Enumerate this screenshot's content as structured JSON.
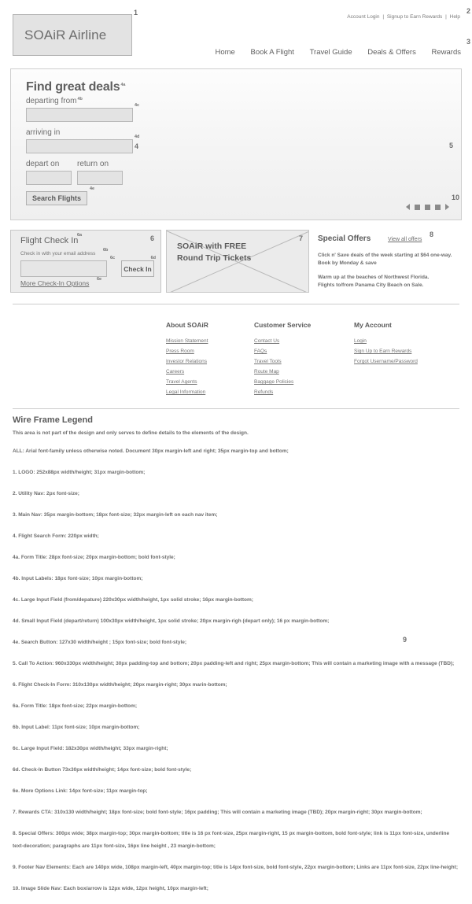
{
  "header": {
    "logo_text": "SOAiR Airline",
    "marker_logo": "1",
    "utility_nav": {
      "marker": "2",
      "items": [
        "Account Login",
        "Signup to Earn Rewards",
        "Help"
      ],
      "separator": "|"
    },
    "main_nav": {
      "marker": "3",
      "items": [
        "Home",
        "Book A Flight",
        "Travel Guide",
        "Deals & Offers",
        "Rewards"
      ]
    }
  },
  "hero": {
    "marker_form": "4",
    "marker_cta_area": "5",
    "form_title": "Find great deals",
    "marker_title": "4a",
    "labels": {
      "departing_from": "departing from",
      "marker_label": "4b",
      "marker_large_field_1": "4c",
      "arriving_in": "arriving in",
      "marker_large_field_2": "4d",
      "depart_on": "depart on",
      "return_on": "return on"
    },
    "fields": {
      "departing_from_value": "",
      "departing_from_placeholder": "",
      "arriving_in_value": "",
      "arriving_in_placeholder": "",
      "depart_on_value": "",
      "depart_on_placeholder": "",
      "return_on_value": "",
      "return_on_placeholder": ""
    },
    "search_button": "Search Flights",
    "marker_search_button": "4e",
    "slide_nav": {
      "marker": "10",
      "prev_icon": "triangle-left-icon",
      "next_icon": "triangle-right-icon",
      "dot_count": 3
    }
  },
  "checkin": {
    "marker": "6",
    "title": "Flight Check In",
    "marker_title": "6a",
    "subtitle": "Check in with your email address",
    "marker_subtitle": "6b",
    "marker_input": "6c",
    "input_value": "",
    "input_placeholder": "",
    "button": "Check In",
    "marker_button": "6d",
    "more_options_link": "More Check-In Options",
    "marker_link": "6e"
  },
  "cta": {
    "marker": "7",
    "line1": "SOAiR with FREE",
    "line2": "Round Trip Tickets"
  },
  "special_offers": {
    "marker": "8",
    "title": "Special Offers",
    "view_all_link": "View all offers",
    "paragraphs": [
      "Click n' Save deals of the week starting at $64 one-way.\nBook by Monday & save",
      "Warm up at the beaches of Northwest Florida.\nFlights to/from Panama City Beach on Sale."
    ],
    "paragraph_lines": [
      [
        "Click n' Save deals of the week starting at $64 one-way.",
        "Book by Monday & save"
      ],
      [
        "Warm up at the beaches of Northwest Florida.",
        "Flights to/from Panama City Beach on Sale."
      ]
    ]
  },
  "footer": {
    "marker": "9",
    "columns": [
      {
        "title": "About SOAiR",
        "links": [
          "Mission Statement",
          "Press Room",
          "Investor Relations",
          "Careers",
          "Travel Agents",
          "Legal Information"
        ]
      },
      {
        "title": "Customer Service",
        "links": [
          "Contact Us",
          "FAQs",
          "Travel Tools",
          "Route Map",
          "Baggage Policies",
          "Refunds"
        ]
      },
      {
        "title": "My Account",
        "links": [
          "Login",
          "Sign Up to Earn Rewards",
          "Forgot Username/Password"
        ]
      }
    ]
  },
  "legend": {
    "title": "Wire Frame Legend",
    "subtitle": "This area is not part of the design and only serves to define details to the elements of the design.",
    "items": [
      "ALL: Arial font-family unless otherwise noted. Document 30px margin-left and right; 35px margin-top and bottom;",
      "1. LOGO: 252x88px width/height; 31px margin-bottom;",
      "2. Utility Nav: 2px font-size;",
      "3. Main Nav: 35px margin-bottom; 18px font-size; 32px margin-left on each nav item;",
      "4. Flight Search Form: 220px width;",
      "4a. Form Title: 28px font-size; 20px margin-bottom; bold font-style;",
      "4b. Input Labels: 18px font-size; 10px margin-bottom;",
      "4c. Large Input Field (from/depature) 220x30px width/height, 1px solid stroke; 16px margin-bottom;",
      "4d. Small Input Field (depart/return) 100x30px width/height, 1px solid stroke; 20px margin-righ (depart only); 16 px margin-bottom;",
      "4e. Search Button: 127x30 width/height ; 15px font-size; bold font-style;",
      "5. Call To Action: 960x330px  width/height; 30px padding-top and bottom; 20px padding-left and right; 25px margin-bottom; This will contain a marketing image with a message (TBD);",
      "6. Flight Check-In Form: 310x130px width/height; 20px margin-right; 30px marin-bottom;",
      "6a. Form Title: 18px font-size; 22px margin-bottom;",
      "6b. Input Label: 11px font-size; 10px margin-bottom;",
      "6c. Large Input Field: 182x30px width/height; 33px margin-right;",
      "6d. Check-In Button 73x30px width/height; 14px font-size; bold font-style;",
      "6e. More Options Link: 14px font-size; 11px margin-top;",
      "7. Rewards CTA: 310x130 width/height; 18px font-size; bold font-style; 16px padding; This will contain a marketing image (TBD); 20px margin-right; 30px margin-bottom;",
      "8. Special Offers: 300px wide; 38px margin-top; 30px margin-bottom; title is 16 px font-size, 25px margin-right, 15 px margin-bottom, bold font-style; link is 11px font-size, underline text-decoration; paragraphs are 11px font-size, 16px line height , 23 margin-bottom;",
      "9. Footer Nav Elements: Each are 140px wide, 108px margin-left, 40px margin-top; title is 14px font-size, bold font-style, 22px margin-bottom; Links are 11px font-size, 22px line-height;",
      "10. Image Slide Nav: Each box/arrow is 12px wide, 12px height, 10px margin-left;"
    ]
  },
  "colors": {
    "text": "#6b6b6b",
    "border": "#c0c0c0",
    "field_fill": "#e3e3e3",
    "panel_fill": "#ececec"
  }
}
